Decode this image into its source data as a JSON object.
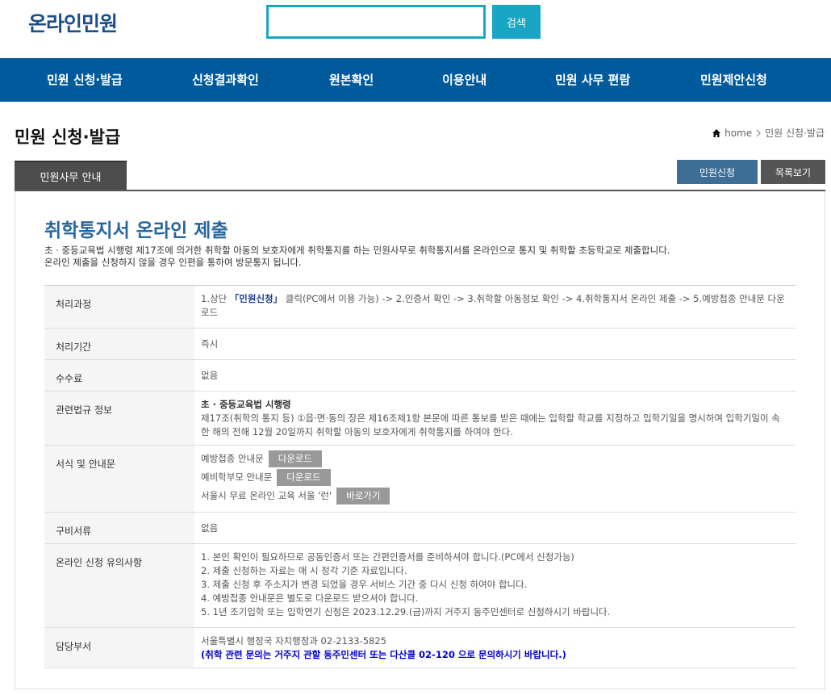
{
  "header": {
    "logo": "온라인민원",
    "search_placeholder": "",
    "search_button": "검색"
  },
  "nav": [
    "민원 신청·발급",
    "신청결과확인",
    "원본확인",
    "이용안내",
    "민원 사무 편람",
    "민원제안신청"
  ],
  "page": {
    "title": "민원 신청·발급",
    "breadcrumb_home": "home",
    "breadcrumb_current": "민원 신청·발급",
    "tab": "민원사무 안내",
    "apply_button": "민원신청",
    "list_button": "목록보기"
  },
  "content": {
    "heading": "취학통지서 온라인 제출",
    "intro_line1": "초 · 중등교육법 시행령 제17조에 의거한 취학할 아동의 보호자에게 취학통지를 하는 민원사무로 취학통지서를 온라인으로 통지 및 취학할 초등학교로 제출합니다.",
    "intro_line2": "온라인 제출을 신청하지 않을 경우 인편을 통하여 방문통지 됩니다."
  },
  "table": {
    "process_label": "처리과정",
    "process_pre": "1.상단 ",
    "process_link": "「민원신청」",
    "process_post": " 클릭(PC에서 이용 가능) -> 2.인증서 확인 -> 3.취학할 아동정보 확인 -> 4.취학통지서 온라인 제출 -> 5.예방접종 안내문 다운로드",
    "period_label": "처리기간",
    "period_value": "즉시",
    "fee_label": "수수료",
    "fee_value": "없음",
    "law_label": "관련법규 정보",
    "law_title": "초 · 중등교육법 시행령",
    "law_text": "제17조(취학의 통지 등) ①읍·면·동의 장은 제16조제1항 본문에 따른 통보를 받은 때에는 입학할 학교를 지정하고 입학기일을 명시하여 입학기일이 속한 해의 전해 12월 20일까지 취학할 아동의 보호자에게 취학통지를 하여야 한다.",
    "forms_label": "서식 및 안내문",
    "form1": "예방접종 안내문",
    "form2": "예비학부모 안내문",
    "form3": "서울시 무료 온라인 교육 서울 '런'",
    "download_label": "다운로드",
    "goto_label": "바로가기",
    "docs_label": "구비서류",
    "docs_value": "없음",
    "notes_label": "온라인 신청 유의사항",
    "notes": [
      "1. 본인 확인이 필요하므로 공동인증서 또는 간편인증서를 준비하셔야 합니다.(PC에서 신청가능)",
      "2. 제출 신청하는 자료는 매 시 정각 기준 자료입니다.",
      "3. 제출 신청 후 주소지가 변경 되었을 경우 서비스 기간 중 다시 신청 하여야 합니다.",
      "4. 예방접종 안내문은 별도로 다운로드 받으셔야 합니다.",
      "5. 1년 조기입학 또는 입학연기 신청은 2023.12.29.(금)까지 거주지 동주민센터로 신청하시기 바랍니다."
    ],
    "dept_label": "담당부서",
    "dept_value": "서울특별시 행정국 자치행정과 02-2133-5825",
    "dept_notice": "(취학 관련 문의는 거주지 관할 동주민센터 또는 다산콜 02-120 으로 문의하시기 바랍니다.)"
  }
}
